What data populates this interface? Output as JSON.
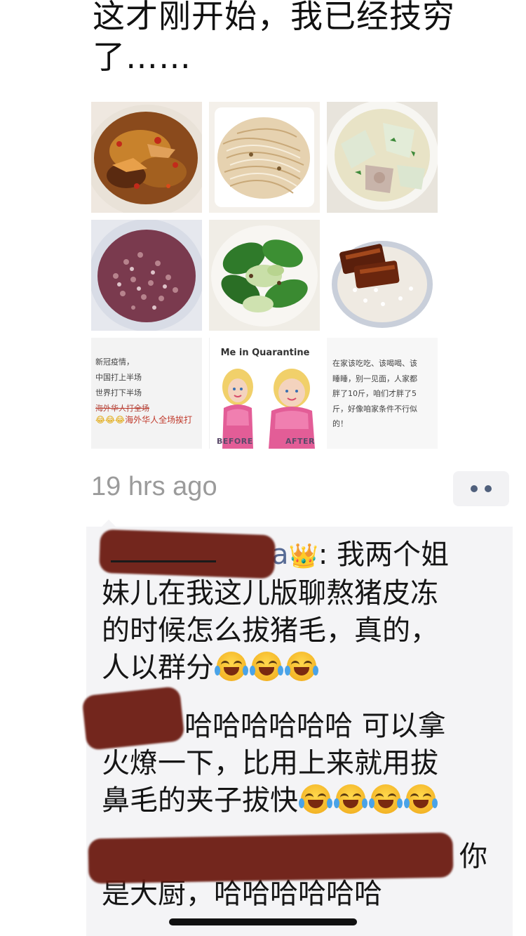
{
  "post": {
    "text_line1": "这才刚开始，我已经技穷",
    "text_line2": "了……"
  },
  "images": [
    {
      "name": "food-photo-spicy-fish"
    },
    {
      "name": "food-photo-shredded-tofu"
    },
    {
      "name": "food-photo-soup"
    },
    {
      "name": "food-photo-purple-rice"
    },
    {
      "name": "food-photo-bok-choy"
    },
    {
      "name": "food-photo-eel-rice"
    },
    {
      "name": "meme-text-tile",
      "lines": [
        "新冠疫情，",
        "中国打上半场",
        "世界打下半场",
        "海外华人打全场"
      ],
      "emoji": "😂😂😂",
      "red_text": "海外华人全场挨打"
    },
    {
      "name": "quarantine-meme",
      "title": "Me in Quarantine",
      "before": "BEFORE",
      "after": "AFTER"
    },
    {
      "name": "note-text-tile",
      "text": "在家该吃吃、该喝喝、该\n睡睡，别一见面，人家都\n胖了10斤，咱们才胖了5\n斤，好像咱家条件不行似\n的！"
    }
  ],
  "meta": {
    "time": "19 hrs ago"
  },
  "comments": [
    {
      "tail": "a",
      "crown": "👑",
      "text": ": 我两个姐妹儿在我这儿版聊熬猪皮冻的时候怎么拔猪毛，真的，人以群分"
    },
    {
      "text": "哈哈哈哈哈哈 可以拿火燎一下，比用上来就用拔鼻毛的夹子拔快"
    },
    {
      "text": "你是大厨，哈哈哈哈哈哈"
    }
  ],
  "comment_lines": {
    "c1_l1": ": 我两个姐",
    "c1_l2": "妹儿在我这儿版聊熬猪皮冻",
    "c1_l3": "的时候怎么拔猪毛，真的，",
    "c1_l4": "人以群分",
    "c2_l1": "哈哈哈哈哈哈 可以拿",
    "c2_l2": "火燎一下，比用上来就用拔",
    "c2_l3": "鼻毛的夹子拔快",
    "c3_l1": "你",
    "c3_l2": "是大厨，哈哈哈哈哈哈"
  }
}
